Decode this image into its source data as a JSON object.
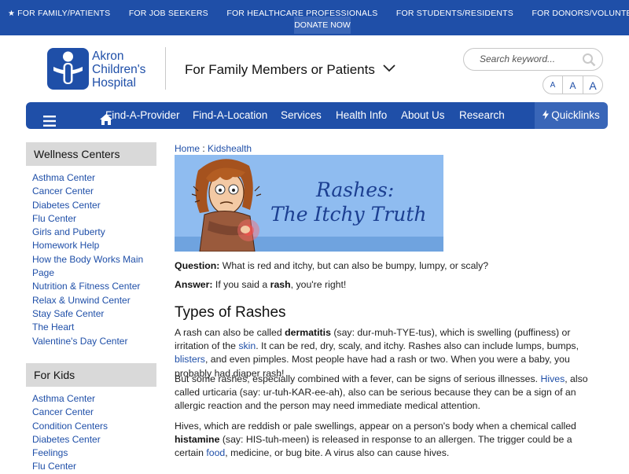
{
  "topbar": {
    "links": [
      "FOR FAMILY/PATIENTS",
      "FOR JOB SEEKERS",
      "FOR HEALTHCARE PROFESSIONALS",
      "FOR STUDENTS/RESIDENTS",
      "FOR DONORS/VOLUNTEERS"
    ],
    "donate": "DONATE NOW"
  },
  "header": {
    "logo_line1": "Akron",
    "logo_line2": "Children's",
    "logo_line3": "Hospital",
    "audience": "For Family Members or Patients",
    "search_placeholder": "Search keyword...",
    "text_sizes": [
      "A",
      "A",
      "A"
    ]
  },
  "nav": {
    "items": [
      "Find-A-Provider",
      "Find-A-Location",
      "Services",
      "Health Info",
      "About Us",
      "Research"
    ],
    "quicklinks": "Quicklinks"
  },
  "sidebar": {
    "wellness_heading": "Wellness Centers",
    "wellness_items": [
      "Asthma Center",
      "Cancer Center",
      "Diabetes Center",
      "Flu Center",
      "Girls and Puberty",
      "Homework Help",
      "How the Body Works Main Page",
      "Nutrition & Fitness Center",
      "Relax & Unwind Center",
      "Stay Safe Center",
      "The Heart",
      "Valentine's Day Center"
    ],
    "kids_heading": "For Kids",
    "kids_items": [
      "Asthma Center",
      "Cancer Center",
      "Condition Centers",
      "Diabetes Center",
      "Feelings",
      "Flu Center"
    ]
  },
  "content": {
    "breadcrumb_home": "Home",
    "breadcrumb_sep": ":",
    "breadcrumb_current": "Kidshealth",
    "hero_line1": "Rashes:",
    "hero_line2": "The Itchy Truth",
    "question_label": "Question:",
    "question_text": " What is red and itchy, but can also be bumpy, lumpy, or scaly?",
    "answer_label": "Answer:",
    "answer_pre": " If you said a ",
    "answer_bold": "rash",
    "answer_post": ", you're right!",
    "types_heading": "Types of Rashes",
    "p1_a": "A rash can also be called ",
    "p1_bold": "dermatitis",
    "p1_b": " (say: dur-muh-TYE-tus), which is swelling (puffiness) or irritation of the ",
    "p1_link1": "skin",
    "p1_c": ". It can be red, dry, scaly, and itchy. Rashes also can include lumps, bumps, ",
    "p1_link2": "blisters",
    "p1_d": ", and even pimples. Most people have had a rash or two. When you were a baby, you probably had diaper rash!",
    "p2_a": "But some rashes, especially combined with a fever, can be signs of serious illnesses. ",
    "p2_link": "Hives",
    "p2_b": ", also called urticaria (say: ur-tuh-KAR-ee-ah), also can be serious because they can be a sign of an allergic reaction and the person may need immediate medical attention.",
    "p3_a": "Hives, which are reddish or pale swellings, appear on a person's body when a chemical called ",
    "p3_bold": "histamine",
    "p3_b": " (say: HIS-tuh-meen) is released in response to an allergen. The trigger could be a certain ",
    "p3_link": "food",
    "p3_c": ", medicine, or bug bite. A virus also can cause hives."
  },
  "colors": {
    "brand_blue": "#1f4fa8",
    "quicklinks_bg": "#3966b8",
    "sidebar_heading_bg": "#d9d9d9",
    "hero_bg": "#8fbcf0"
  },
  "icons": [
    "star-icon",
    "chevron-down-icon",
    "search-icon",
    "menu-icon",
    "home-icon",
    "lightning-icon",
    "logo-icon"
  ]
}
